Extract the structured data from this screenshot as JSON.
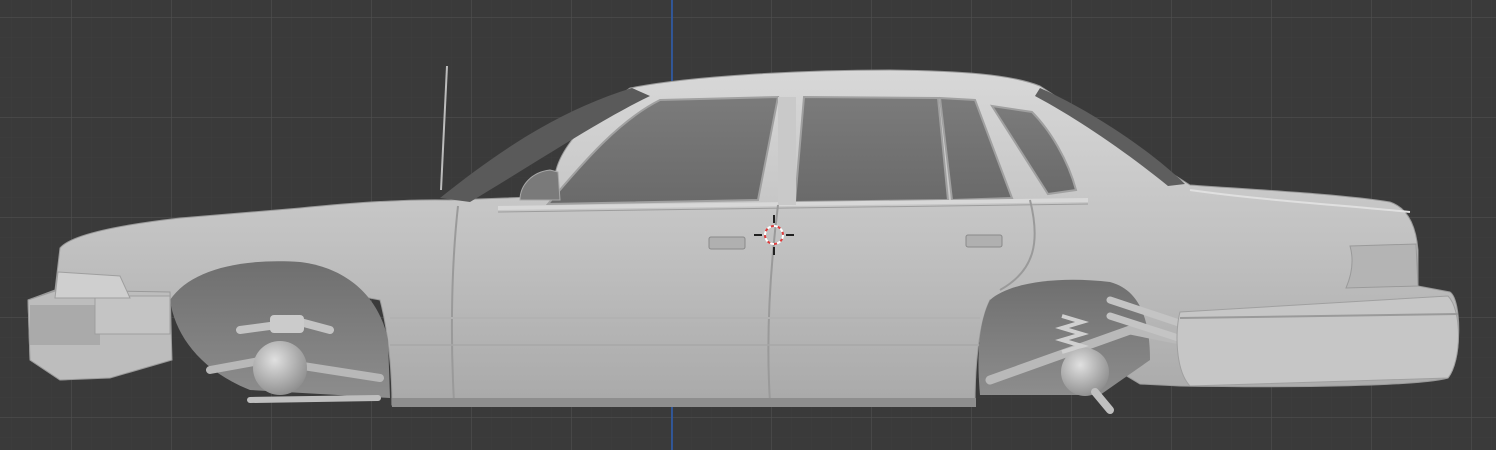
{
  "viewport": {
    "view": "side-orthographic",
    "background_color": "#3a3a3a",
    "grid_color": "#505050",
    "axis_color": "#2f5aa6",
    "object": "sedan-car-model",
    "icons": {
      "cursor": "3d-cursor-icon"
    }
  }
}
